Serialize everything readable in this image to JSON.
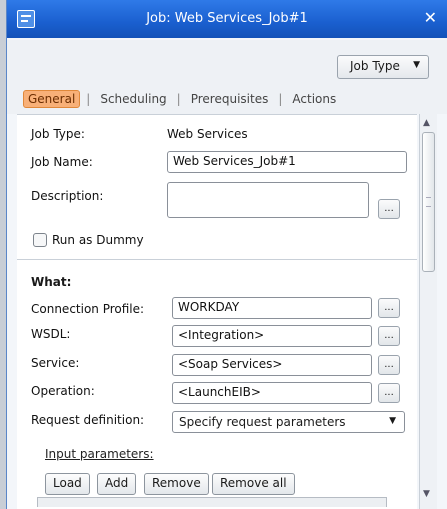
{
  "window": {
    "title": "Job: Web Services_Job#1",
    "close": "✕"
  },
  "toolbar": {
    "job_type_button": "Job Type",
    "job_type_arrow": "▼"
  },
  "tabs": [
    "General",
    "Scheduling",
    "Prerequisites",
    "Actions"
  ],
  "tab_separator": "|",
  "general": {
    "job_type_label": "Job Type:",
    "job_type_value": "Web Services",
    "job_name_label": "Job Name:",
    "job_name_value": "Web Services_Job#1",
    "description_label": "Description:",
    "description_value": "",
    "run_as_dummy_label": "Run as Dummy"
  },
  "what": {
    "section_title": "What:",
    "connection_profile_label": "Connection Profile:",
    "connection_profile_value": "WORKDAY",
    "wsdl_label": "WSDL:",
    "wsdl_value": "<Integration>",
    "service_label": "Service:",
    "service_value": "<Soap Services>",
    "operation_label": "Operation:",
    "operation_value": "<LaunchEIB>",
    "request_definition_label": "Request definition:",
    "request_definition_value": "Specify request parameters",
    "request_definition_arrow": "▼",
    "input_parameters_label": "Input parameters:",
    "buttons": {
      "load": "Load",
      "add": "Add",
      "remove": "Remove",
      "remove_all": "Remove all"
    }
  },
  "common": {
    "ellipsis": "..."
  },
  "scroll": {
    "up": "▲",
    "down": "▼"
  },
  "colors": {
    "titlebar": "#1a5fcf",
    "active_tab": "#f8b078"
  }
}
